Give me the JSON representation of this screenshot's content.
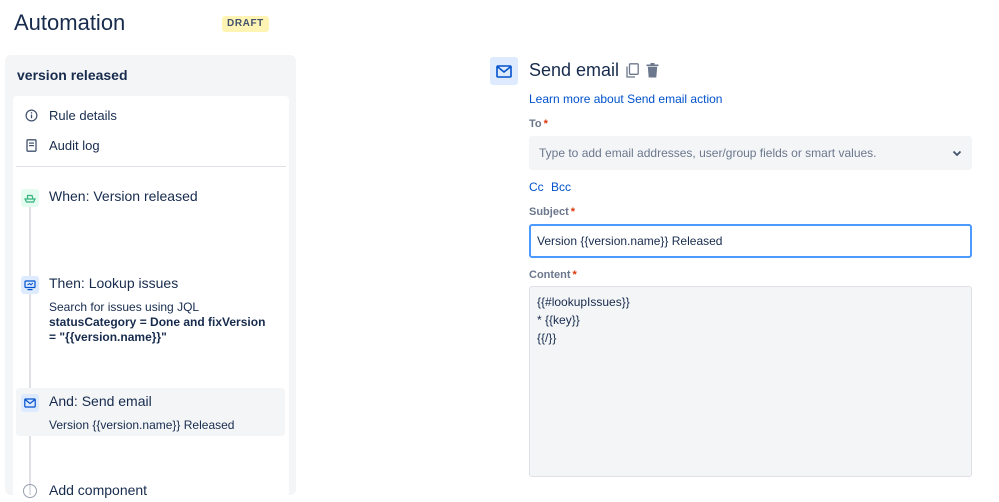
{
  "header": {
    "title": "Automation",
    "status_badge": "DRAFT"
  },
  "sidebar": {
    "rule_name": "version released",
    "menu": [
      {
        "label": "Rule details",
        "icon": "info-icon"
      },
      {
        "label": "Audit log",
        "icon": "document-icon"
      }
    ],
    "steps": {
      "trigger": {
        "title": "When: Version released",
        "icon": "ship-icon",
        "icon_color": "#36b37e"
      },
      "lookup": {
        "title": "Then: Lookup issues",
        "desc_prefix": "Search for issues using JQL",
        "desc_jql_line1": "statusCategory = Done and fixVersion",
        "desc_jql_line2": "= \"{{version.name}}\"",
        "icon": "monitor-icon"
      },
      "send_email": {
        "title": "And: Send email",
        "desc": "Version {{version.name}} Released",
        "icon": "envelope-icon"
      },
      "add_component": {
        "title": "Add component"
      }
    }
  },
  "action": {
    "title": "Send email",
    "icon": "envelope-icon",
    "learn_more": "Learn more about Send email action",
    "to_label": "To",
    "to_placeholder": "Type to add email addresses, user/group fields or smart values.",
    "cc_label": "Cc",
    "bcc_label": "Bcc",
    "subject_label": "Subject",
    "subject_value": "Version {{version.name}} Released",
    "content_label": "Content",
    "content_lines": [
      "{{#lookupIssues}}",
      "* {{key}}",
      "{{/}}"
    ]
  },
  "colors": {
    "accent": "#0052cc",
    "focus": "#4c9aff",
    "required": "#de350b",
    "badge_bg": "#fff4b3"
  }
}
